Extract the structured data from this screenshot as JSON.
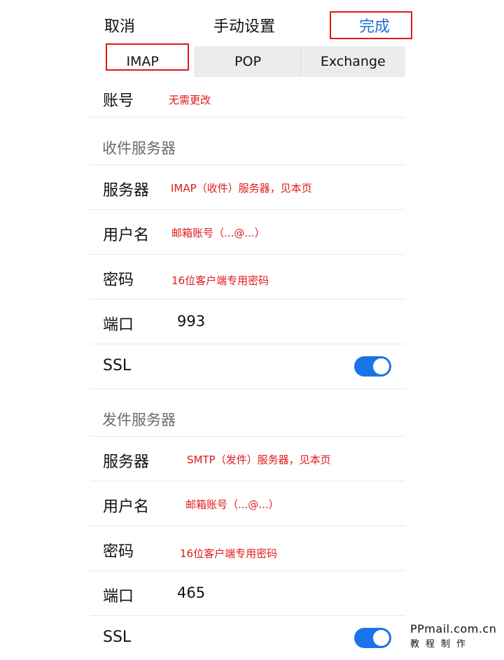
{
  "nav": {
    "cancel": "取消",
    "title": "手动设置",
    "done": "完成"
  },
  "tabs": [
    "IMAP",
    "POP",
    "Exchange"
  ],
  "account": {
    "label": "账号",
    "note": "无需更改"
  },
  "incoming": {
    "section_title": "收件服务器",
    "server_label": "服务器",
    "server_note": "IMAP（收件）服务器，见本页",
    "user_label": "用户名",
    "user_note": "邮箱账号（...@...）",
    "pwd_label": "密码",
    "pwd_note": "16位客户端专用密码",
    "port_label": "端口",
    "port_value": "993",
    "ssl_label": "SSL",
    "ssl_on": true
  },
  "outgoing": {
    "section_title": "发件服务器",
    "server_label": "服务器",
    "server_note": "SMTP（发件）服务器，见本页",
    "user_label": "用户名",
    "user_note": "邮箱账号（...@...）",
    "pwd_label": "密码",
    "pwd_note": "16位客户端专用密码",
    "port_label": "端口",
    "port_value": "465",
    "ssl_label": "SSL",
    "ssl_on": true
  },
  "watermark": {
    "line1": "PPmail.com.cn",
    "line2": "教程制作"
  },
  "colors": {
    "accent": "#1a73e8",
    "annotation": "#e01919"
  }
}
